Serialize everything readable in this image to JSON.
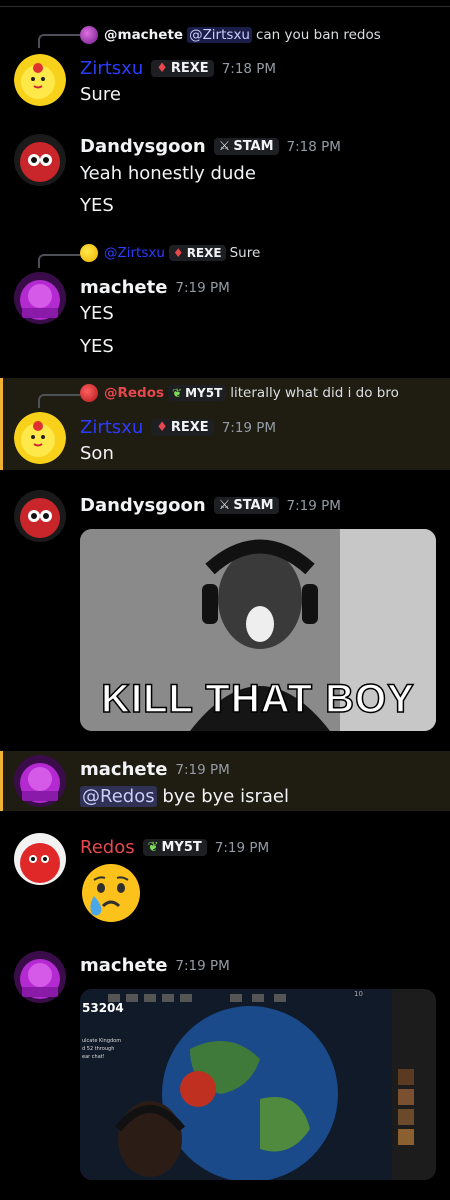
{
  "messages": [
    {
      "reply": {
        "author": "@machete",
        "mention": "@Zirtsxu",
        "text": "can you ban redos"
      },
      "author": "Zirtsxu",
      "tag": "REXE",
      "time": "7:18 PM",
      "lines": [
        "Sure"
      ]
    },
    {
      "author": "Dandysgoon",
      "tag": "STAM",
      "time": "7:18 PM",
      "lines": [
        "Yeah honestly dude",
        "YES"
      ]
    },
    {
      "reply": {
        "author": "@Zirtsxu",
        "tag": "REXE",
        "text": "Sure"
      },
      "author": "machete",
      "time": "7:19 PM",
      "lines": [
        "YES",
        "YES"
      ]
    },
    {
      "reply": {
        "author": "@Redos",
        "tag": "MY5T",
        "text": "literally what did i do bro"
      },
      "author": "Zirtsxu",
      "tag": "REXE",
      "time": "7:19 PM",
      "lines": [
        "Son"
      ]
    },
    {
      "author": "Dandysgoon",
      "tag": "STAM",
      "time": "7:19 PM",
      "gif_caption": "KILL THAT BOY"
    },
    {
      "author": "machete",
      "time": "7:19 PM",
      "mention": "@Redos",
      "text": "bye bye israel"
    },
    {
      "author": "Redos",
      "tag": "MY5T",
      "time": "7:19 PM"
    },
    {
      "author": "machete",
      "time": "7:19 PM",
      "image_text": {
        "score": "53204",
        "sub1": "ulcate Kingdom",
        "sub2": "d 52 through",
        "sub3": "ear chat!",
        "top_right": "10"
      }
    }
  ],
  "colors": {
    "highlight_bar": "#f0b232",
    "zirtsxu_name": "#2c3cff",
    "redos_name": "#e5484d",
    "timestamp": "#949ba4"
  },
  "icons": [
    "reply-connector-icon",
    "gem-icon",
    "sword-icon",
    "leaf-icon",
    "crying-face-emoji"
  ]
}
